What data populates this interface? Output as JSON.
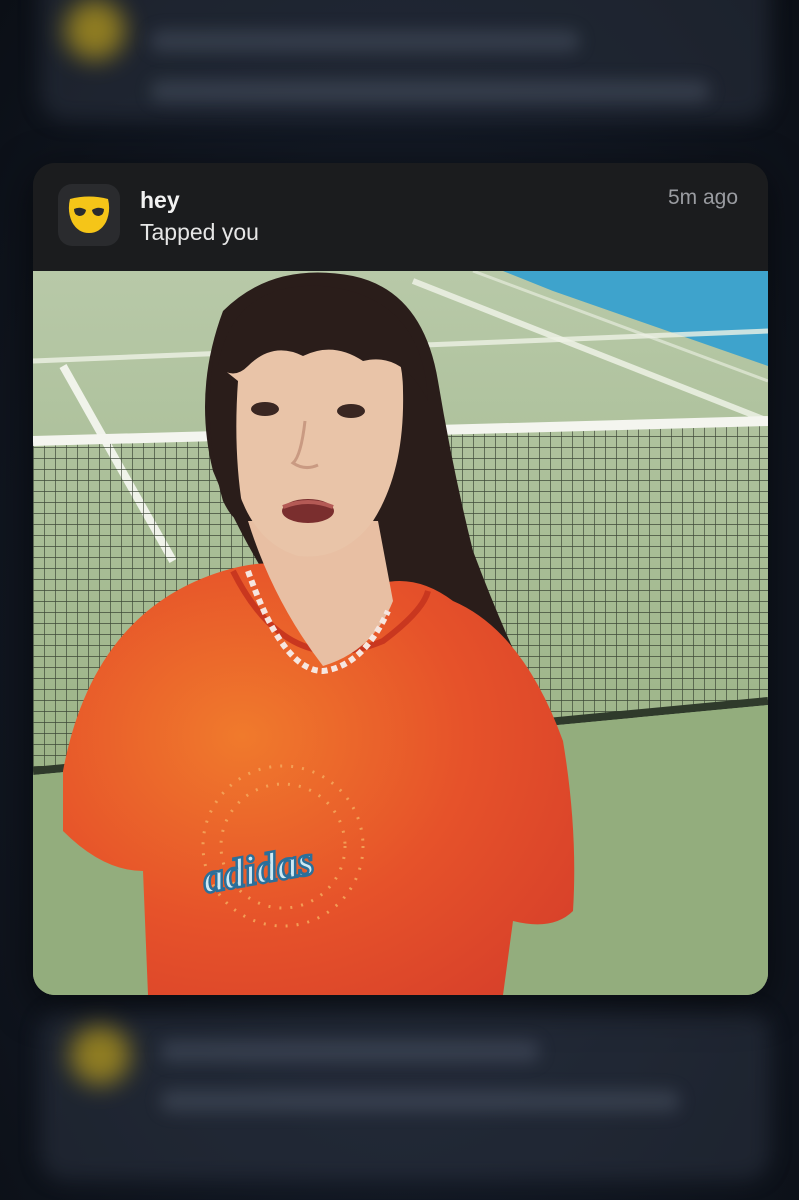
{
  "notification": {
    "app_icon": "grindr-mask-icon",
    "title": "hey",
    "subtitle": "Tapped you",
    "time": "5m ago"
  },
  "media": {
    "shirt_text": "adidas"
  },
  "colors": {
    "card_background": "#1b1c1e",
    "app_icon_yellow": "#f5c518",
    "text_primary": "#f2f2f2",
    "text_secondary": "#9a9ca1"
  }
}
